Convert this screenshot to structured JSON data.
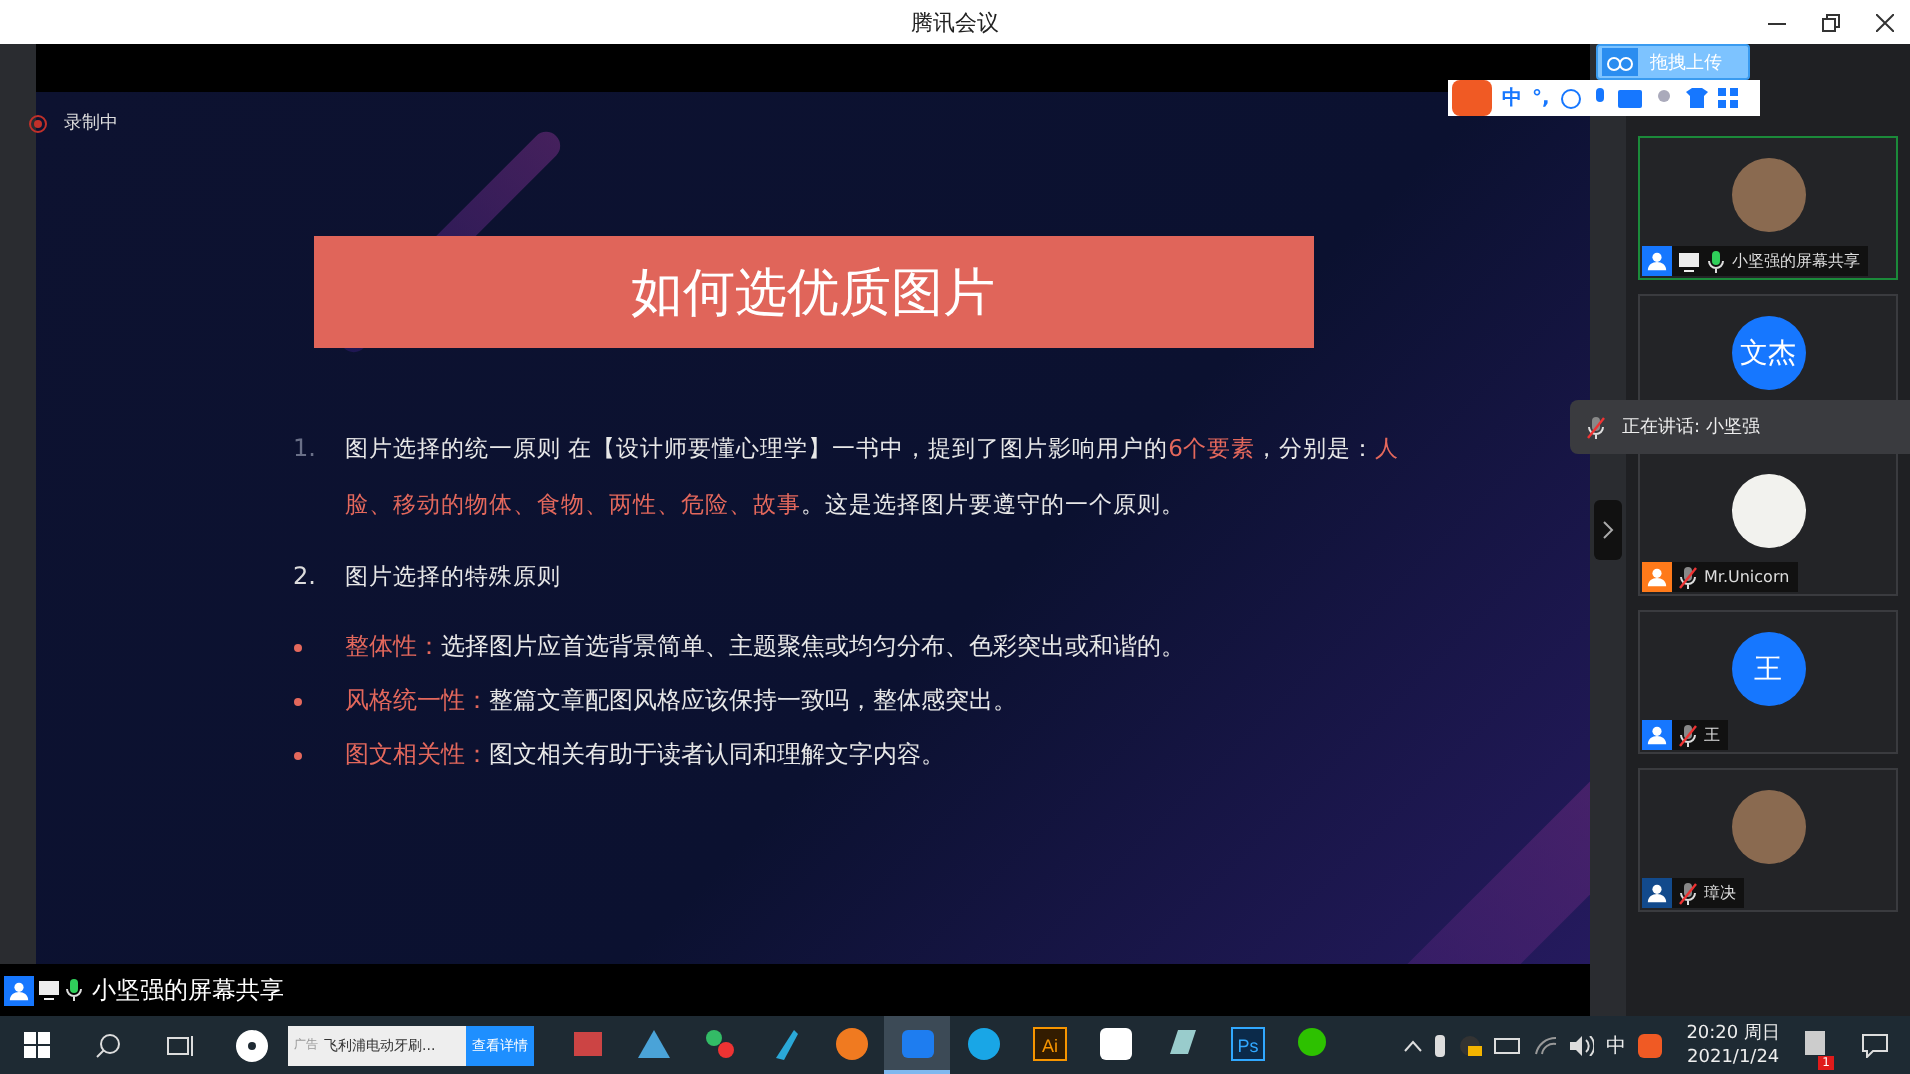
{
  "window": {
    "title": "腾讯会议"
  },
  "recording": {
    "label": "录制中"
  },
  "upload_button": {
    "label": "拖拽上传"
  },
  "ime_toolbar": {
    "mode": "中",
    "punctuation": "°,"
  },
  "slide": {
    "title": "如何选优质图片",
    "sections": [
      {
        "number": "1.",
        "dimmed": true,
        "segments": [
          {
            "text": "图片选择的统一原则 在【设计师要懂心理学】一书中，提到了图片影响用户的",
            "highlight": false
          },
          {
            "text": "6个要素",
            "highlight": true
          },
          {
            "text": "，分别是：",
            "highlight": false
          },
          {
            "text": "人脸、移动的物体、食物、两性、危险、故事",
            "highlight": true
          },
          {
            "text": "。这是选择图片要遵守的一个原则。",
            "highlight": false
          }
        ]
      },
      {
        "number": "2.",
        "dimmed": false,
        "segments": [
          {
            "text": "图片选择的特殊原则",
            "highlight": false
          }
        ]
      }
    ],
    "bullets": [
      {
        "term": "整体性：",
        "text": "选择图片应首选背景简单、主题聚焦或均匀分布、色彩突出或和谐的。"
      },
      {
        "term": "风格统一性：",
        "text": "整篇文章配图风格应该保持一致吗，整体感突出。"
      },
      {
        "term": "图文相关性：",
        "text": "图文相关有助于读者认同和理解文字内容。"
      }
    ]
  },
  "participants": [
    {
      "name": "小坚强的屏幕共享",
      "avatar": {
        "kind": "photo"
      },
      "color": "#1677ff",
      "muted": false,
      "sharing": true,
      "selected": true
    },
    {
      "avatar": {
        "kind": "initials",
        "label": "文杰"
      },
      "selected": false
    },
    {
      "name": "Mr.Unicorn",
      "avatar": {
        "kind": "drawing"
      },
      "color": "#ff7a1a",
      "muted": true,
      "selected": false
    },
    {
      "name": "王",
      "avatar": {
        "kind": "initials",
        "label": "王"
      },
      "color": "#1677ff",
      "muted": true,
      "selected": false
    },
    {
      "name": "璋决",
      "avatar": {
        "kind": "photo"
      },
      "color": "#124a8c",
      "muted": true,
      "selected": false
    }
  ],
  "speaking_tooltip": {
    "label": "正在讲话: 小坚强"
  },
  "share_label": {
    "label": "小坚强的屏幕共享"
  },
  "taskbar": {
    "ad": {
      "tag": "广告",
      "text": "飞利浦电动牙刷...",
      "button": "查看详情"
    },
    "apps": [
      {
        "kind": "books",
        "selected": false
      },
      {
        "kind": "prism",
        "selected": false
      },
      {
        "kind": "molecule",
        "selected": false
      },
      {
        "kind": "pen",
        "selected": false
      },
      {
        "kind": "orb",
        "selected": false
      },
      {
        "kind": "meeting",
        "selected": true
      },
      {
        "kind": "folder",
        "selected": false
      },
      {
        "kind": "ai",
        "label": "Ai",
        "selected": false
      },
      {
        "kind": "cloud",
        "selected": false
      },
      {
        "kind": "note",
        "selected": false
      },
      {
        "kind": "ps",
        "label": "Ps",
        "selected": false
      },
      {
        "kind": "chat",
        "selected": false
      }
    ],
    "tray": {
      "ime": "中",
      "time": "20:20 周日",
      "date": "2021/1/24",
      "badge": "1"
    }
  }
}
